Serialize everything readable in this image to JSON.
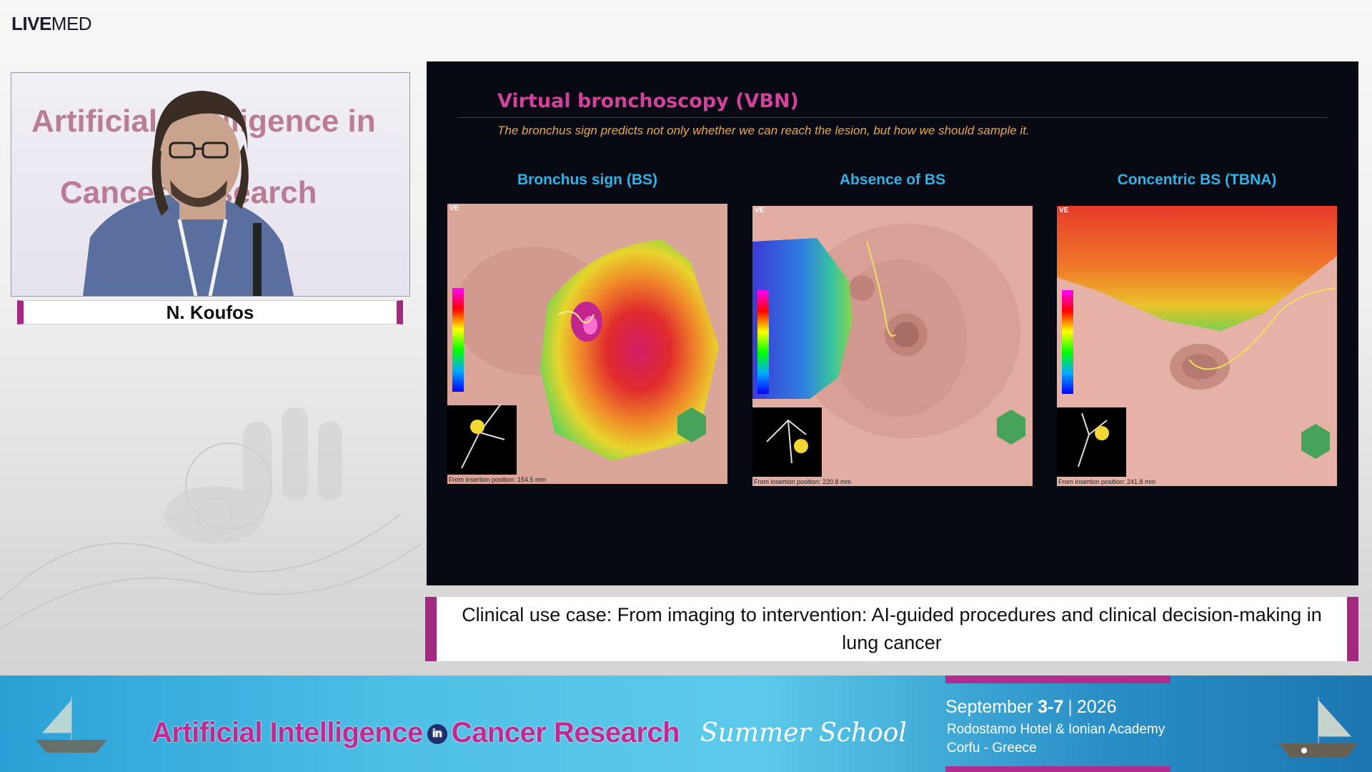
{
  "logo": {
    "live": "LIVE",
    "med": "MED"
  },
  "speaker": {
    "name": "N. Koufos",
    "backdrop_text_line1": "Artificial Intelligence in",
    "backdrop_text_line2": "Cancer Research"
  },
  "slide": {
    "title": "Virtual bronchoscopy (VBN)",
    "subtitle": "The bronchus sign predicts not only whether we can reach the lesion, but how we should sample it.",
    "panels": [
      {
        "heading": "Bronchus sign (BS)",
        "tag": "VE",
        "footer": "From insertion position: 154.5 mm"
      },
      {
        "heading": "Absence of BS",
        "tag": "VE",
        "footer": "From insertion position: 220.8 mm"
      },
      {
        "heading": "Concentric BS (TBNA)",
        "tag": "VE",
        "footer": "From insertion position: 241.8 mm"
      }
    ]
  },
  "caption": "Clinical use case: From imaging to intervention: AI-guided procedures and clinical decision-making in lung cancer",
  "banner": {
    "title_part1": "Artificial Intelligence",
    "title_in": "in",
    "title_part2": "Cancer Research",
    "summer_school": "Summer School",
    "date_month": "September",
    "date_days": "3-7",
    "date_year": "2026",
    "venue_line1": "Rodostamo Hotel & Ionian Academy",
    "venue_line2": "Corfu - Greece"
  },
  "colors": {
    "accent_magenta": "#a3287f",
    "slide_title": "#d2419a",
    "panel_heading": "#2fb3e8",
    "subtitle": "#e9a84b"
  }
}
